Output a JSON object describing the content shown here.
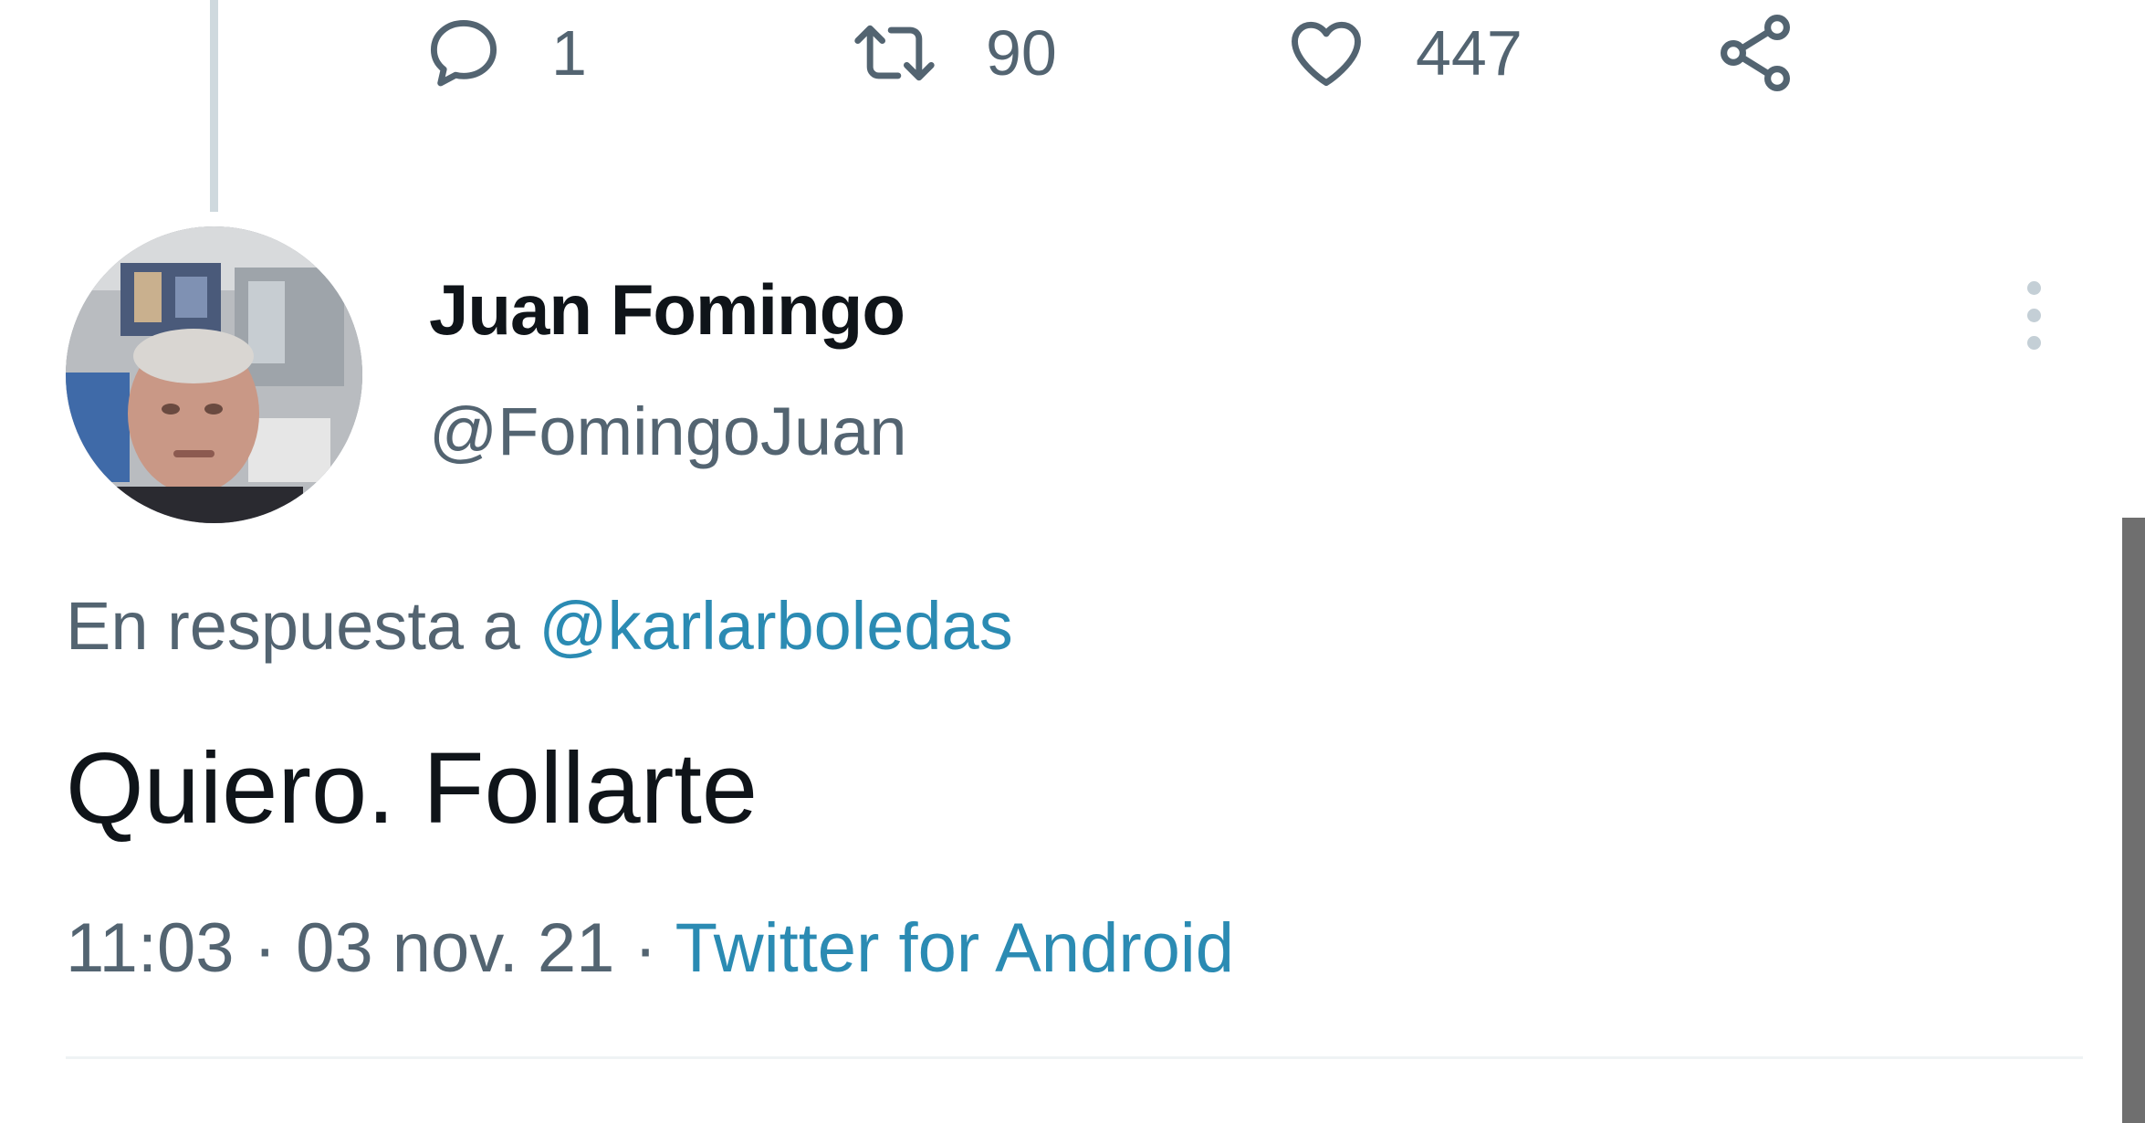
{
  "actions": {
    "reply": {
      "count": "1",
      "icon": "reply-icon"
    },
    "retweet": {
      "count": "90",
      "icon": "retweet-icon"
    },
    "like": {
      "count": "447",
      "icon": "heart-icon"
    },
    "share": {
      "icon": "share-icon"
    }
  },
  "tweet": {
    "author_name": "Juan Fomingo",
    "author_handle": "@FomingoJuan",
    "reply_prefix": "En respuesta a ",
    "reply_to": "@karlarboledas",
    "text": "Quiero. Follarte",
    "time": "11:03",
    "separator1": " · ",
    "date": "03 nov. 21",
    "separator2": " · ",
    "source": "Twitter for Android"
  },
  "colors": {
    "link": "#2b8bb3",
    "secondary_text": "#536471",
    "primary_text": "#0f1419"
  }
}
